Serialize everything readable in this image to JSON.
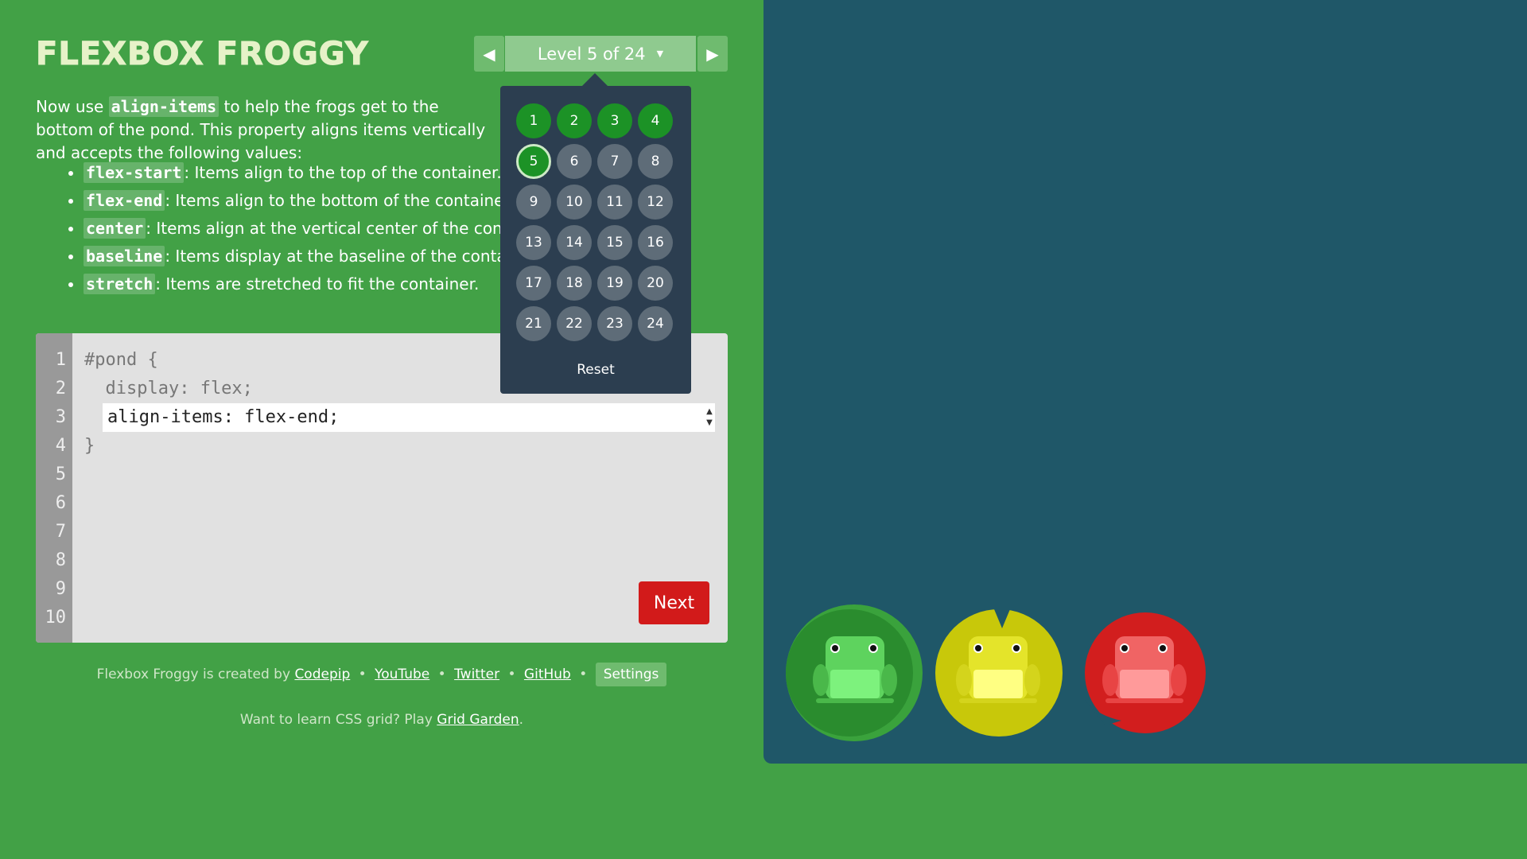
{
  "app": {
    "logo": "FLEXBOX FROGGY"
  },
  "level_selector": {
    "label": "Level 5 of 24",
    "prev_icon": "◀",
    "next_icon": "▶",
    "caret": "▼"
  },
  "instructions": {
    "intro_before": "Now use ",
    "intro_code": "align-items",
    "intro_after": " to help the frogs get to the bottom of the pond. This property aligns items vertically and accepts the following values:",
    "values": [
      {
        "code": "flex-start",
        "desc": ": Items align to the top of the container."
      },
      {
        "code": "flex-end",
        "desc": ": Items align to the bottom of the container."
      },
      {
        "code": "center",
        "desc": ": Items align at the vertical center of the container."
      },
      {
        "code": "baseline",
        "desc": ": Items display at the baseline of the container."
      },
      {
        "code": "stretch",
        "desc": ": Items are stretched to fit the container."
      }
    ]
  },
  "editor": {
    "line_numbers": [
      "1",
      "2",
      "3",
      "4",
      "5",
      "6",
      "7",
      "8",
      "9",
      "10"
    ],
    "line1": "#pond {",
    "line2": "  display: flex;",
    "input_value": "align-items: flex-end;",
    "line4": "}",
    "next_label": "Next"
  },
  "levels_dropdown": {
    "levels": [
      {
        "n": "1",
        "state": "solved"
      },
      {
        "n": "2",
        "state": "solved"
      },
      {
        "n": "3",
        "state": "solved"
      },
      {
        "n": "4",
        "state": "solved"
      },
      {
        "n": "5",
        "state": "current"
      },
      {
        "n": "6",
        "state": "open"
      },
      {
        "n": "7",
        "state": "open"
      },
      {
        "n": "8",
        "state": "open"
      },
      {
        "n": "9",
        "state": "open"
      },
      {
        "n": "10",
        "state": "open"
      },
      {
        "n": "11",
        "state": "open"
      },
      {
        "n": "12",
        "state": "open"
      },
      {
        "n": "13",
        "state": "open"
      },
      {
        "n": "14",
        "state": "open"
      },
      {
        "n": "15",
        "state": "open"
      },
      {
        "n": "16",
        "state": "open"
      },
      {
        "n": "17",
        "state": "open"
      },
      {
        "n": "18",
        "state": "open"
      },
      {
        "n": "19",
        "state": "open"
      },
      {
        "n": "20",
        "state": "open"
      },
      {
        "n": "21",
        "state": "open"
      },
      {
        "n": "22",
        "state": "open"
      },
      {
        "n": "23",
        "state": "open"
      },
      {
        "n": "24",
        "state": "open"
      }
    ],
    "reset_label": "Reset"
  },
  "footer": {
    "created_by": "Flexbox Froggy is created by",
    "links": [
      "Codepip",
      "YouTube",
      "Twitter",
      "GitHub"
    ],
    "bullet": "•",
    "settings_label": "Settings",
    "learn_prefix": "Want to learn CSS grid? Play",
    "learn_link": "Grid Garden",
    "learn_suffix": "."
  },
  "pond": {
    "pads": [
      {
        "name": "green",
        "pad_color": "#2a8c2e",
        "frog_color": "#5ed35e",
        "frog_belly": "#7df27d"
      },
      {
        "name": "yellow",
        "pad_color": "#c8c80a",
        "frog_color": "#e4e42a",
        "frog_belly": "#ffff82"
      },
      {
        "name": "red",
        "pad_color": "#d21e1e",
        "frog_color": "#f06464",
        "frog_belly": "#ff9a9a"
      }
    ]
  }
}
